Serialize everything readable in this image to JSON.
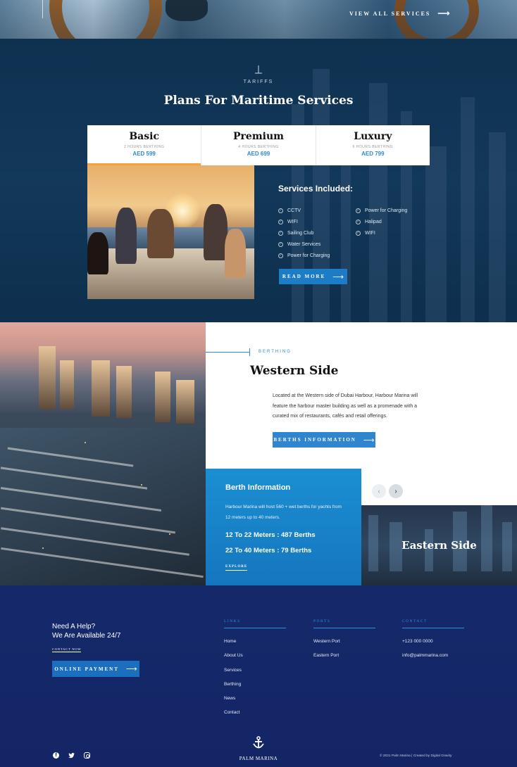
{
  "hero": {
    "view_all": "VIEW ALL SERVICES",
    "arrow": "⟶"
  },
  "tariffs": {
    "eyebrow": "TARIFFS",
    "title": "Plans For Maritime Services",
    "plans": [
      {
        "name": "Basic",
        "sub": "2 HOURS BERTHING",
        "price": "AED 599",
        "active": true
      },
      {
        "name": "Premium",
        "sub": "4 HOURS BERTHING",
        "price": "AED 699",
        "active": false
      },
      {
        "name": "Luxury",
        "sub": "6 HOURS BERTHING",
        "price": "AED 799",
        "active": false
      }
    ],
    "services_title": "Services Included:",
    "services_left": [
      "CCTV",
      "WIFI",
      "Sailing Club",
      "Water Services",
      "Power for Charging"
    ],
    "services_right": [
      "Power for Charging",
      "Halipad",
      "WIFI"
    ],
    "read_more": "READ MORE"
  },
  "berthing": {
    "eyebrow": "BERTHING",
    "title": "Western Side",
    "text": "Located at the Western side of Dubai Harbour, Harbour Marina will feature the harbour master building as well as a promenade with a curated mix of restaurants, cafés and retail offerings.",
    "button": "BERTHS INFORMATION",
    "info": {
      "title": "Berth Information",
      "text": "Harbour Marina will host 560 + wet berths for yachts from 12 meters up to 40 meters.",
      "stat1": "12 To 22 Meters : 487 Berths",
      "stat2": "22 To 40 Meters : 79 Berths",
      "explore": "EXPLORE"
    },
    "eastern_title": "Eastern Side",
    "prev": "‹",
    "next": "›"
  },
  "footer": {
    "help_line1": "Need  A Help?",
    "help_line2": "We Are Available 24/7",
    "contact_now": "CONTACT NOW",
    "online_payment": "ONLINE PAYMENT",
    "links_head": "LINKS",
    "links": [
      "Home",
      "About Us",
      "Services",
      "Berthing",
      "News",
      "Contact"
    ],
    "ports_head": "PORTS",
    "ports": [
      "Western Port",
      "Eastern Port"
    ],
    "contact_head": "CONTACT",
    "contact": [
      "+123 000 0000",
      "info@palmmarina.com"
    ],
    "logo_name": "PALM MARINA",
    "copyright": "© 2021 Palm Marina  |  Created by Digital Gravity"
  },
  "colors": {
    "accent": "#1d7cc6",
    "navy": "#15296a",
    "orange": "#f4a23a"
  }
}
